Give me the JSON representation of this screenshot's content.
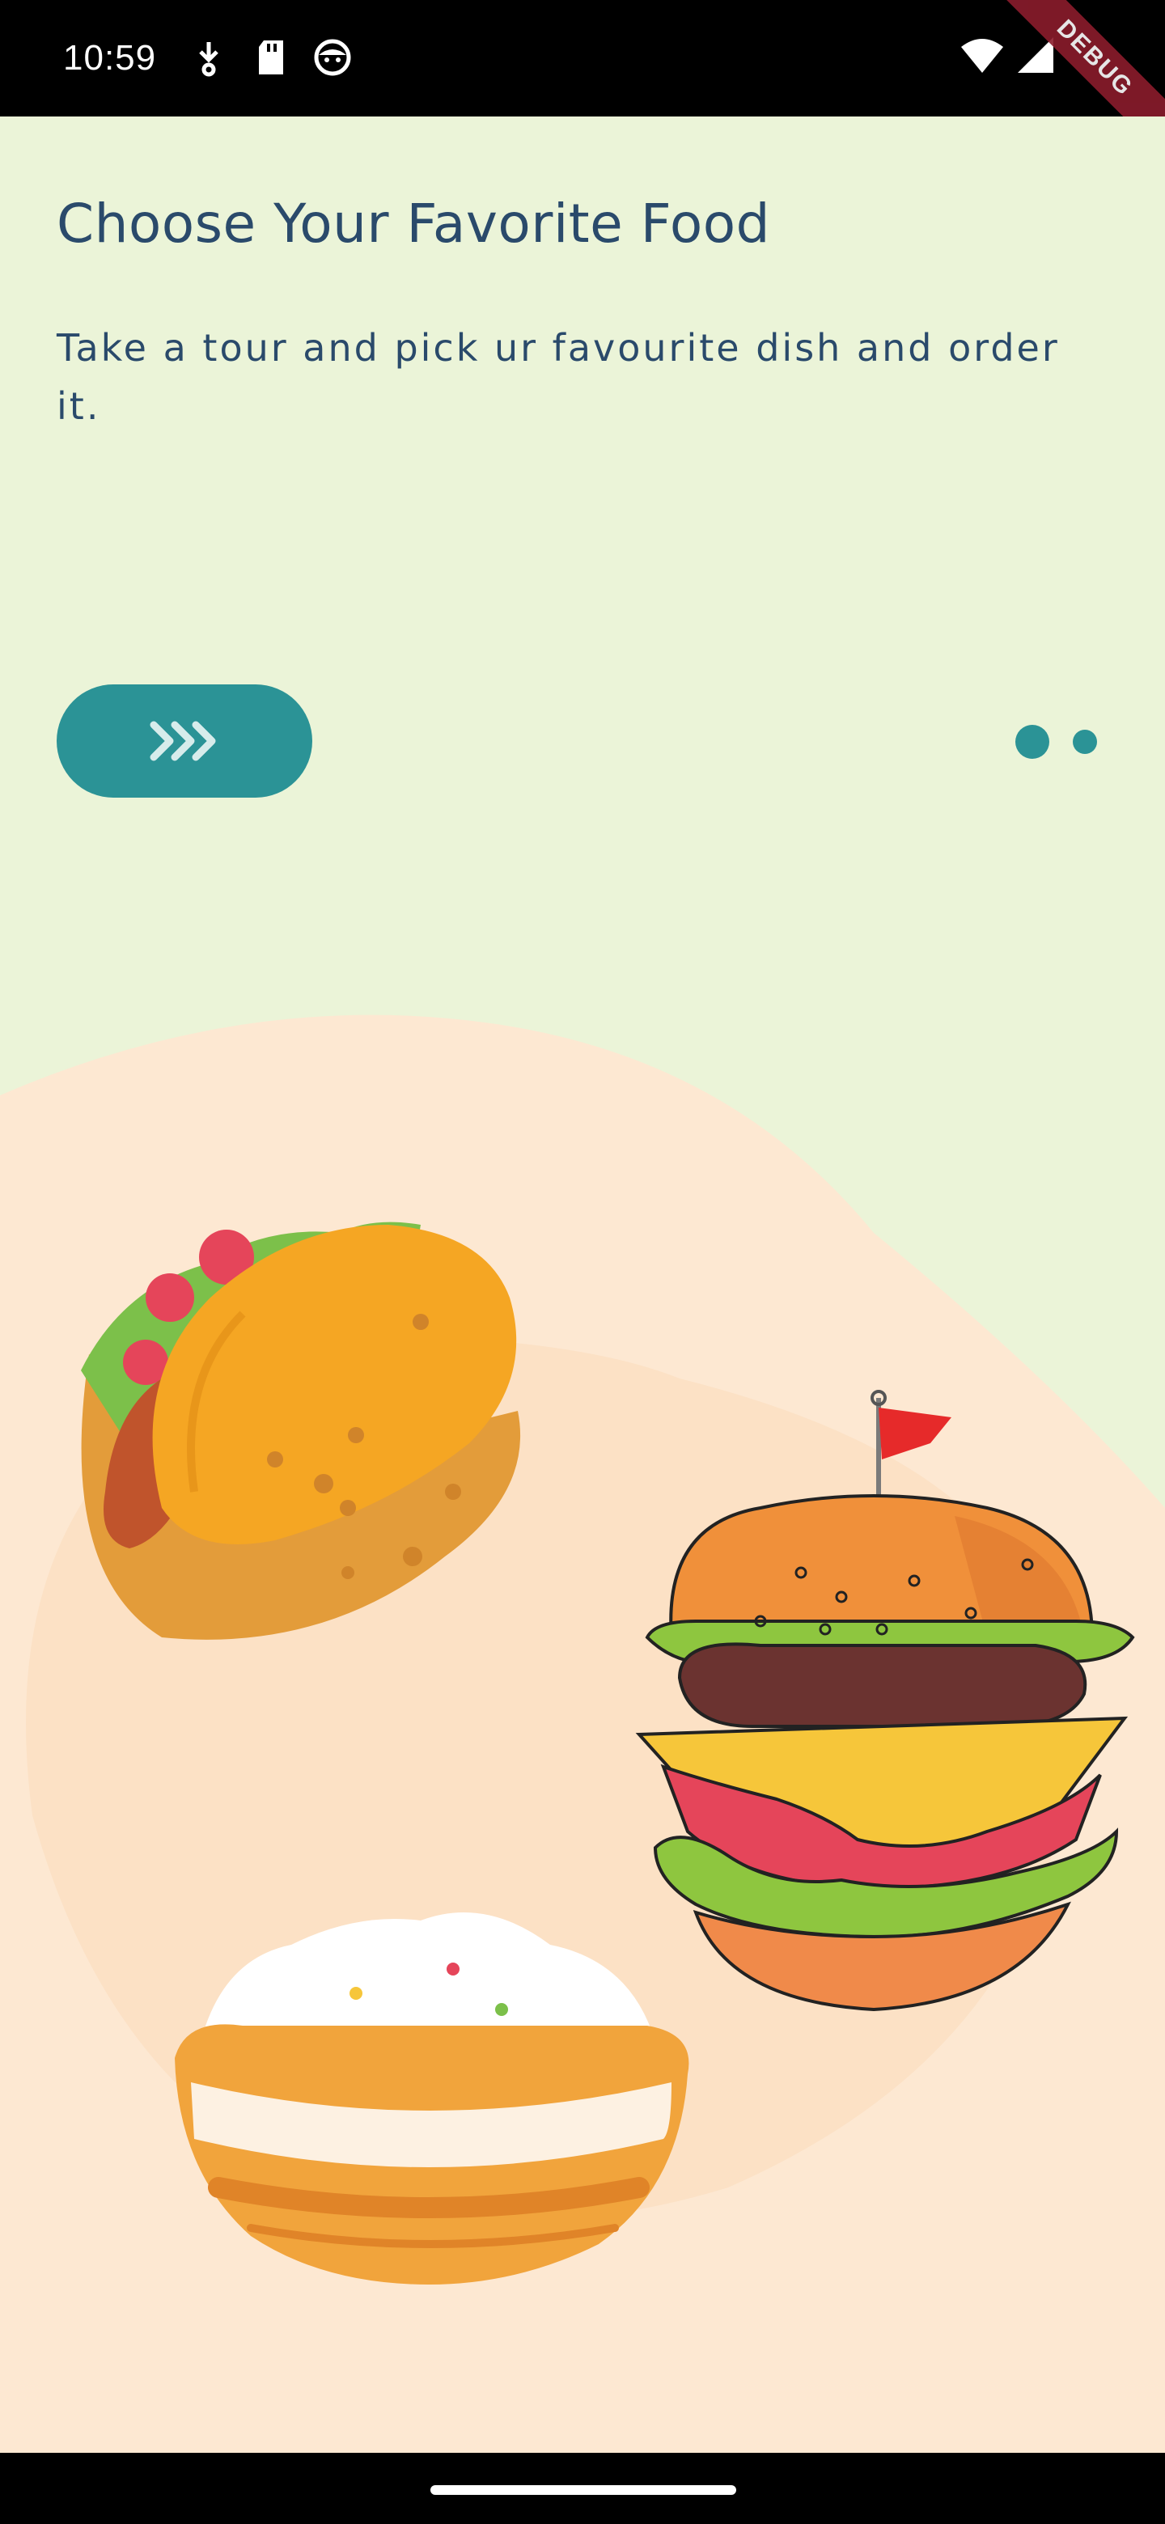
{
  "status_bar": {
    "time": "10:59",
    "icons": [
      "download-icon",
      "sd-card-icon",
      "face-icon",
      "wifi-icon",
      "cellular-signal-icon"
    ],
    "debug_label": "DEBUG"
  },
  "onboarding": {
    "title": "Choose Your Favorite Food",
    "description": "Take a tour and pick ur favourite dish and order it.",
    "next_button_icon": "triple-chevron-right-icon",
    "page_indicator": {
      "total": 2,
      "current": 1
    },
    "illustration_items": [
      "taco",
      "burger",
      "rice-bowl"
    ]
  },
  "colors": {
    "background": "#ebf4d8",
    "accent": "#2b9396",
    "text": "#2a4a6b",
    "blob": "#fde8d2",
    "blob_inner": "#fcdcbc"
  }
}
